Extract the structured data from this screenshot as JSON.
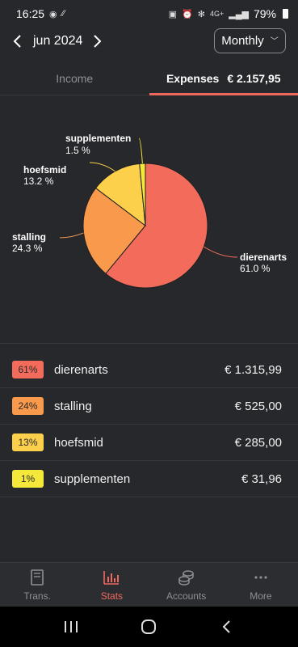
{
  "status_bar": {
    "time": "16:25",
    "network": "4G+",
    "battery": "79%"
  },
  "header": {
    "month": "jun 2024",
    "period": "Monthly"
  },
  "tabs": {
    "income_label": "Income",
    "expenses_label": "Expenses",
    "expenses_total": "€ 2.157,95"
  },
  "chart_data": {
    "type": "pie",
    "title": "",
    "slices": [
      {
        "label": "dierenarts",
        "pct_label": "61.0 %",
        "value": 61.0,
        "color": "#f26b5b"
      },
      {
        "label": "stalling",
        "pct_label": "24.3 %",
        "value": 24.3,
        "color": "#f8994c"
      },
      {
        "label": "hoefsmid",
        "pct_label": "13.2 %",
        "value": 13.2,
        "color": "#fcd04b"
      },
      {
        "label": "supplementen",
        "pct_label": "1.5 %",
        "value": 1.5,
        "color": "#f5e83a"
      }
    ]
  },
  "categories": [
    {
      "pct": "61%",
      "name": "dierenarts",
      "amount": "€ 1.315,99",
      "color": "#f26b5b"
    },
    {
      "pct": "24%",
      "name": "stalling",
      "amount": "€ 525,00",
      "color": "#f8994c"
    },
    {
      "pct": "13%",
      "name": "hoefsmid",
      "amount": "€ 285,00",
      "color": "#fcd04b"
    },
    {
      "pct": "1%",
      "name": "supplementen",
      "amount": "€ 31,96",
      "color": "#f5e83a"
    }
  ],
  "bottom_nav": [
    {
      "label": "Trans.",
      "icon": "book-icon",
      "active": false
    },
    {
      "label": "Stats",
      "icon": "bar-chart-icon",
      "active": true
    },
    {
      "label": "Accounts",
      "icon": "coins-icon",
      "active": false
    },
    {
      "label": "More",
      "icon": "more-dots-icon",
      "active": false
    }
  ],
  "colors": {
    "accent": "#f0675d",
    "background": "#27282c"
  }
}
